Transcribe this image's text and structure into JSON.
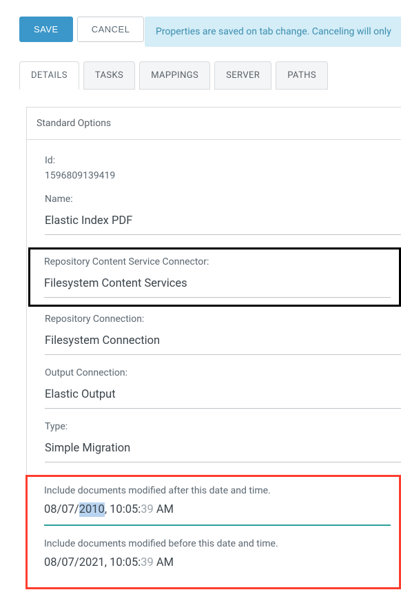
{
  "buttons": {
    "save": "SAVE",
    "cancel": "CANCEL"
  },
  "info_message": "Properties are saved on tab change. Canceling will only",
  "tabs": {
    "details": "DETAILS",
    "tasks": "TASKS",
    "mappings": "MAPPINGS",
    "server": "SERVER",
    "paths": "PATHS"
  },
  "panel": {
    "header": "Standard Options",
    "id_label": "Id:",
    "id_value": "1596809139419",
    "name_label": "Name:",
    "name_value": "Elastic Index PDF",
    "repo_connector_label": "Repository Content Service Connector:",
    "repo_connector_value": "Filesystem Content Services",
    "repo_connection_label": "Repository Connection:",
    "repo_connection_value": "Filesystem Connection",
    "output_connection_label": "Output Connection:",
    "output_connection_value": "Elastic Output",
    "type_label": "Type:",
    "type_value": "Simple Migration",
    "after_label": "Include documents modified after this date and time.",
    "after_prefix": "08/07/",
    "after_year": "2010",
    "after_mid": ", 10:05:",
    "after_sec": "39",
    "after_ampm": " AM",
    "before_label": "Include documents modified before this date and time.",
    "before_prefix": "08/07/2021, 10:05:",
    "before_sec": "39",
    "before_ampm": " AM"
  }
}
